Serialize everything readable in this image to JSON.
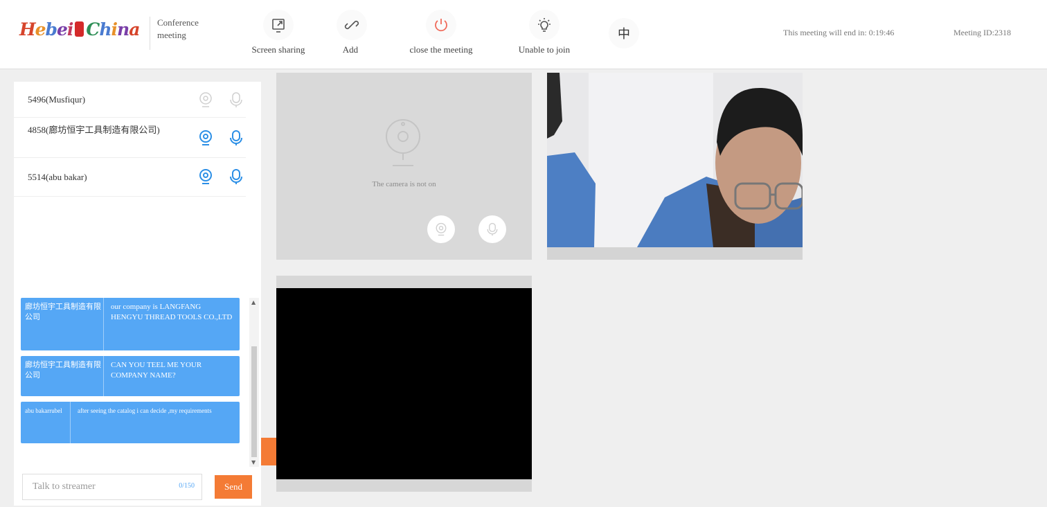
{
  "header": {
    "logo_text": "Hebei China",
    "conference_title": "Conference meeting",
    "toolbar": [
      {
        "label": "Screen sharing",
        "icon": "screen-share-icon"
      },
      {
        "label": "Add",
        "icon": "link-icon"
      },
      {
        "label": "close the meeting",
        "icon": "power-icon"
      },
      {
        "label": "Unable to join",
        "icon": "lightbulb-icon"
      }
    ],
    "language_glyph": "中",
    "countdown": "This meeting will end in:  0:19:46",
    "meeting_id": "Meeting ID:2318"
  },
  "participants": [
    {
      "name": "5496(Musfiqur)",
      "camera_on": false,
      "mic_on": false
    },
    {
      "name": "4858(廊坊恒宇工具制造有限公司)",
      "camera_on": true,
      "mic_on": true
    },
    {
      "name": "5514(abu bakar)",
      "camera_on": true,
      "mic_on": true
    }
  ],
  "chat": {
    "messages": [
      {
        "sender": "廊坊恒宇工具制造有限公司",
        "text": "our company is LANGFANG HENGYU THREAD TOOLS CO.,LTD"
      },
      {
        "sender": "廊坊恒宇工具制造有限公司",
        "text": "CAN YOU TEEL ME YOUR COMPANY NAME?"
      },
      {
        "sender": "abu bakarrubel",
        "text": "after seeing the catalog i can decide ,my requirements"
      }
    ],
    "input_placeholder": "Talk to streamer",
    "char_counter": "0/150",
    "send_label": "Send"
  },
  "video_tiles": {
    "camera_off_text": "The camera is not on"
  },
  "colors": {
    "accent_blue": "#55a7f5",
    "send_orange": "#f47b35",
    "close_red": "#f06a5a"
  }
}
